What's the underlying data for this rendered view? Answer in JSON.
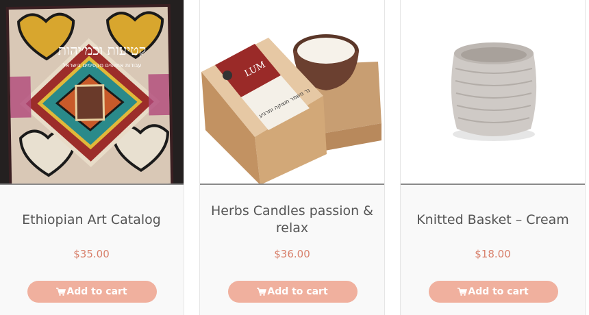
{
  "products": [
    {
      "title": "Ethiopian Art Catalog",
      "price": "$35.00",
      "button": "Add to cart",
      "cover_text": "קטיעות וכמ׳יהות",
      "cover_subtitle": "עבודות אתיופים מקסימים בישראל"
    },
    {
      "title": "Herbs Candles passion & relax",
      "price": "$36.00",
      "button": "Add to cart",
      "box_brand": "LUM",
      "box_text": "נר משמר תשוקה ומרגיע"
    },
    {
      "title": "Knitted Basket – Cream",
      "price": "$18.00",
      "button": "Add to cart"
    }
  ],
  "colors": {
    "price": "#d8806b",
    "button_bg": "#f0b09e",
    "title": "#555555"
  },
  "icons": {
    "cart": "shopping-cart-icon"
  }
}
